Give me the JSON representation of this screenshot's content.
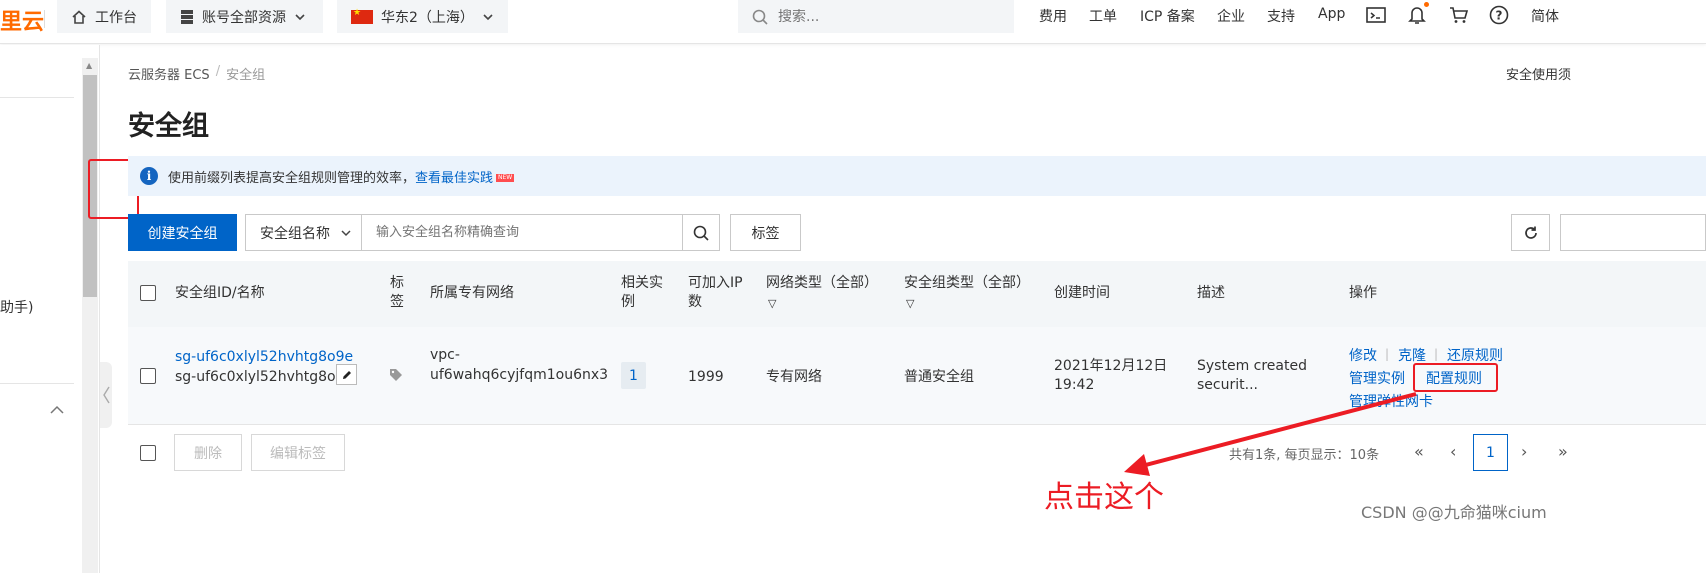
{
  "topbar": {
    "logo": "里云",
    "workbench": "工作台",
    "resources": "账号全部资源",
    "region": "华东2（上海）",
    "search_placeholder": "搜索...",
    "nav": [
      "费用",
      "工单",
      "ICP 备案",
      "企业",
      "支持",
      "App"
    ],
    "lang": "简体"
  },
  "sidebar": {
    "partial_label": "助手)"
  },
  "breadcrumb": {
    "root": "云服务器 ECS",
    "current": "安全组"
  },
  "help_link": "安全使用须",
  "page_title": "安全组",
  "info_bar": {
    "text": "使用前缀列表提高安全组规则管理的效率，",
    "link": "查看最佳实践",
    "badge": "NEW"
  },
  "toolbar": {
    "create_label": "创建安全组",
    "filter_field": "安全组名称",
    "search_placeholder": "输入安全组名称精确查询",
    "tag_label": "标签"
  },
  "table": {
    "headers": {
      "id_name": "安全组ID/名称",
      "tag_1": "标",
      "tag_2": "签",
      "vpc": "所属专有网络",
      "instances_1": "相关实",
      "instances_2": "例",
      "ip_1": "可加入IP",
      "ip_2": "数",
      "network_type": "网络类型（全部）",
      "sg_type": "安全组类型（全部）",
      "created": "创建时间",
      "description": "描述",
      "actions": "操作"
    },
    "rows": [
      {
        "id": "sg-uf6c0xlyl52hvhtg8o9e",
        "name": "sg-uf6c0xlyl52hvhtg8o9...",
        "vpc_1": "vpc-",
        "vpc_2": "uf6wahq6cyjfqm1ou6nx3",
        "instances": "1",
        "ip_count": "1999",
        "network_type": "专有网络",
        "sg_type": "普通安全组",
        "created_date": "2021年12月12日",
        "created_time": "19:42",
        "desc_1": "System created",
        "desc_2": "securit...",
        "actions": {
          "modify": "修改",
          "clone": "克隆",
          "restore": "还原规则",
          "manage_instances": "管理实例",
          "config_rules": "配置规则",
          "manage_eni": "管理弹性网卡"
        }
      }
    ]
  },
  "footer": {
    "delete_label": "删除",
    "edit_tags_label": "编辑标签",
    "pager_text": "共有1条, 每页显示：10条",
    "first": "«",
    "prev": "‹",
    "current_page": "1",
    "next": "›",
    "last": "»"
  },
  "annotation": "点击这个",
  "watermark": "CSDN @@九命猫咪cium",
  "colors": {
    "accent": "#0064c8",
    "brand": "#ff6a00",
    "annotation": "#ec1c24"
  }
}
